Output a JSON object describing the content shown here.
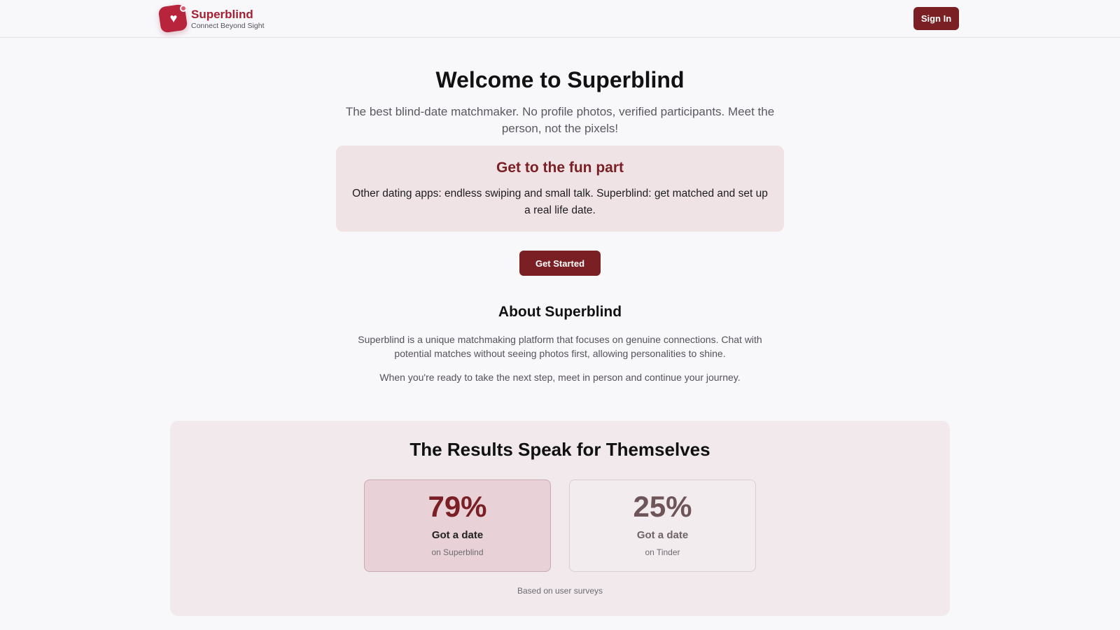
{
  "header": {
    "brand_name": "Superblind",
    "brand_tagline": "Connect Beyond Sight",
    "sign_in_label": "Sign In"
  },
  "hero": {
    "title": "Welcome to Superblind",
    "subtitle": "The best blind-date matchmaker. No profile photos, verified participants. Meet the person, not the pixels!",
    "callout_title": "Get to the fun part",
    "callout_text": "Other dating apps: endless swiping and small talk. Superblind: get matched and set up a real life date.",
    "cta_label": "Get Started"
  },
  "about": {
    "title": "About Superblind",
    "paragraph1": "Superblind is a unique matchmaking platform that focuses on genuine connections. Chat with potential matches without seeing photos first, allowing personalities to shine.",
    "paragraph2": "When you're ready to take the next step, meet in person and continue your journey."
  },
  "results": {
    "title": "The Results Speak for Themselves",
    "stats": [
      {
        "value": "79%",
        "label": "Got a date",
        "sub": "on Superblind"
      },
      {
        "value": "25%",
        "label": "Got a date",
        "sub": "on Tinder"
      }
    ],
    "note": "Based on user surveys"
  },
  "colors": {
    "brand": "#a51f33",
    "button": "#7a1f24",
    "callout_bg": "#f0e3e6"
  },
  "icons": {
    "logo": "heart-icon"
  }
}
